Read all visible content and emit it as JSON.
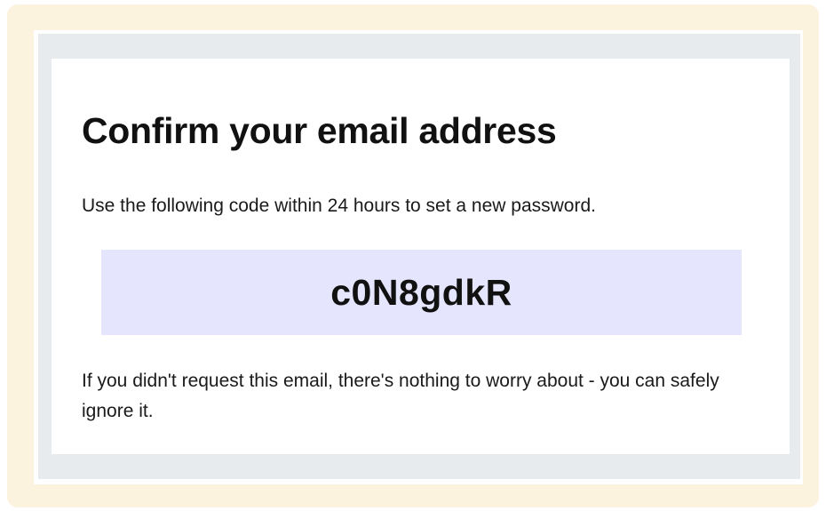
{
  "email": {
    "title": "Confirm your email address",
    "instructions": "Use the following code within 24 hours to set a new password.",
    "code": "c0N8gdkR",
    "footer": "If you didn't request this email, there's nothing to worry about - you can safely ignore it."
  },
  "colors": {
    "outer_frame": "#fbf3dd",
    "email_background": "#e8ebee",
    "card": "#ffffff",
    "code_box": "#e5e5fd",
    "text": "#111111"
  }
}
